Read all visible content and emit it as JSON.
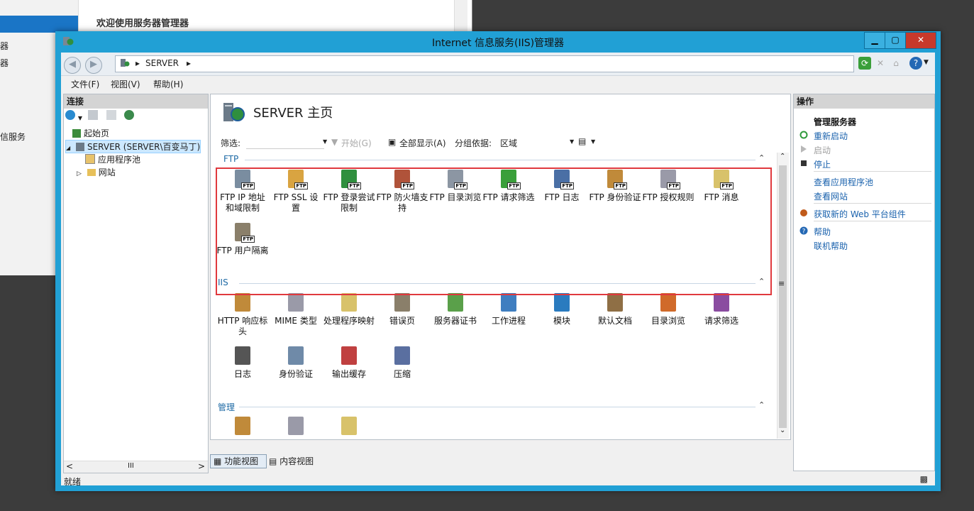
{
  "background_window": {
    "title": "欢迎使用服务器管理器",
    "side_texts": [
      "器",
      "器",
      "信服务"
    ]
  },
  "window": {
    "title": "Internet 信息服务(IIS)管理器",
    "minimize_glyph": "▁",
    "maximize_glyph": "▢",
    "close_glyph": "✕"
  },
  "address": {
    "segments": [
      "SERVER"
    ]
  },
  "menu": [
    "文件(F)",
    "视图(V)",
    "帮助(H)"
  ],
  "connections": {
    "header": "连接",
    "tree": [
      {
        "label": "起始页"
      },
      {
        "label": "SERVER (SERVER\\百变马丁)"
      },
      {
        "label": "应用程序池"
      },
      {
        "label": "网站"
      }
    ],
    "scroll_mid": "III"
  },
  "center": {
    "title": "SERVER 主页",
    "filter": {
      "label": "筛选:",
      "start_label": "开始(G)",
      "show_all_label": "全部显示(A)",
      "group_by_label": "分组依据:",
      "group_by_value": "区域"
    },
    "groups": {
      "ftp": {
        "name": "FTP",
        "items": [
          {
            "label": "FTP IP 地址和域限制",
            "icon": "ftp-ip-icon"
          },
          {
            "label": "FTP SSL 设置",
            "icon": "ftp-ssl-icon"
          },
          {
            "label": "FTP 登录尝试限制",
            "icon": "ftp-logon-icon"
          },
          {
            "label": "FTP 防火墙支持",
            "icon": "ftp-firewall-icon"
          },
          {
            "label": "FTP 目录浏览",
            "icon": "ftp-dir-icon"
          },
          {
            "label": "FTP 请求筛选",
            "icon": "ftp-filter-icon"
          },
          {
            "label": "FTP 日志",
            "icon": "ftp-log-icon"
          },
          {
            "label": "FTP 身份验证",
            "icon": "ftp-auth-icon"
          },
          {
            "label": "FTP 授权规则",
            "icon": "ftp-authz-icon"
          },
          {
            "label": "FTP 消息",
            "icon": "ftp-msg-icon"
          },
          {
            "label": "FTP 用户隔离",
            "icon": "ftp-isolation-icon"
          }
        ]
      },
      "iis": {
        "name": "IIS",
        "items": [
          {
            "label": "HTTP 响应标头",
            "icon": "http-headers-icon"
          },
          {
            "label": "MIME 类型",
            "icon": "mime-icon"
          },
          {
            "label": "处理程序映射",
            "icon": "handler-icon"
          },
          {
            "label": "错误页",
            "icon": "error-page-icon"
          },
          {
            "label": "服务器证书",
            "icon": "cert-icon"
          },
          {
            "label": "工作进程",
            "icon": "worker-icon"
          },
          {
            "label": "模块",
            "icon": "modules-icon"
          },
          {
            "label": "默认文档",
            "icon": "default-doc-icon"
          },
          {
            "label": "目录浏览",
            "icon": "dir-browse-icon"
          },
          {
            "label": "请求筛选",
            "icon": "request-filter-icon"
          },
          {
            "label": "日志",
            "icon": "log-icon"
          },
          {
            "label": "身份验证",
            "icon": "auth-icon"
          },
          {
            "label": "输出缓存",
            "icon": "output-cache-icon"
          },
          {
            "label": "压缩",
            "icon": "compress-icon"
          }
        ]
      },
      "mgmt": {
        "name": "管理",
        "items": [
          {
            "label": "",
            "icon": "feature-delegation-icon"
          },
          {
            "label": "",
            "icon": "config-editor-icon"
          },
          {
            "label": "",
            "icon": "shared-config-icon"
          }
        ]
      }
    }
  },
  "view_tabs": {
    "features": "功能视图",
    "content": "内容视图"
  },
  "actions": {
    "header": "操作",
    "manage_server": "管理服务器",
    "restart": "重新启动",
    "start": "启动",
    "stop": "停止",
    "view_apppools": "查看应用程序池",
    "view_sites": "查看网站",
    "get_web_platform": "获取新的 Web 平台组件",
    "help": "帮助",
    "online_help": "联机帮助"
  },
  "status": {
    "text": "就绪"
  },
  "colors": {
    "window_frame": "#21a0d5",
    "link": "#1a62ad",
    "highlight_box": "#e0393e",
    "group_header": "#1e6aa5"
  }
}
